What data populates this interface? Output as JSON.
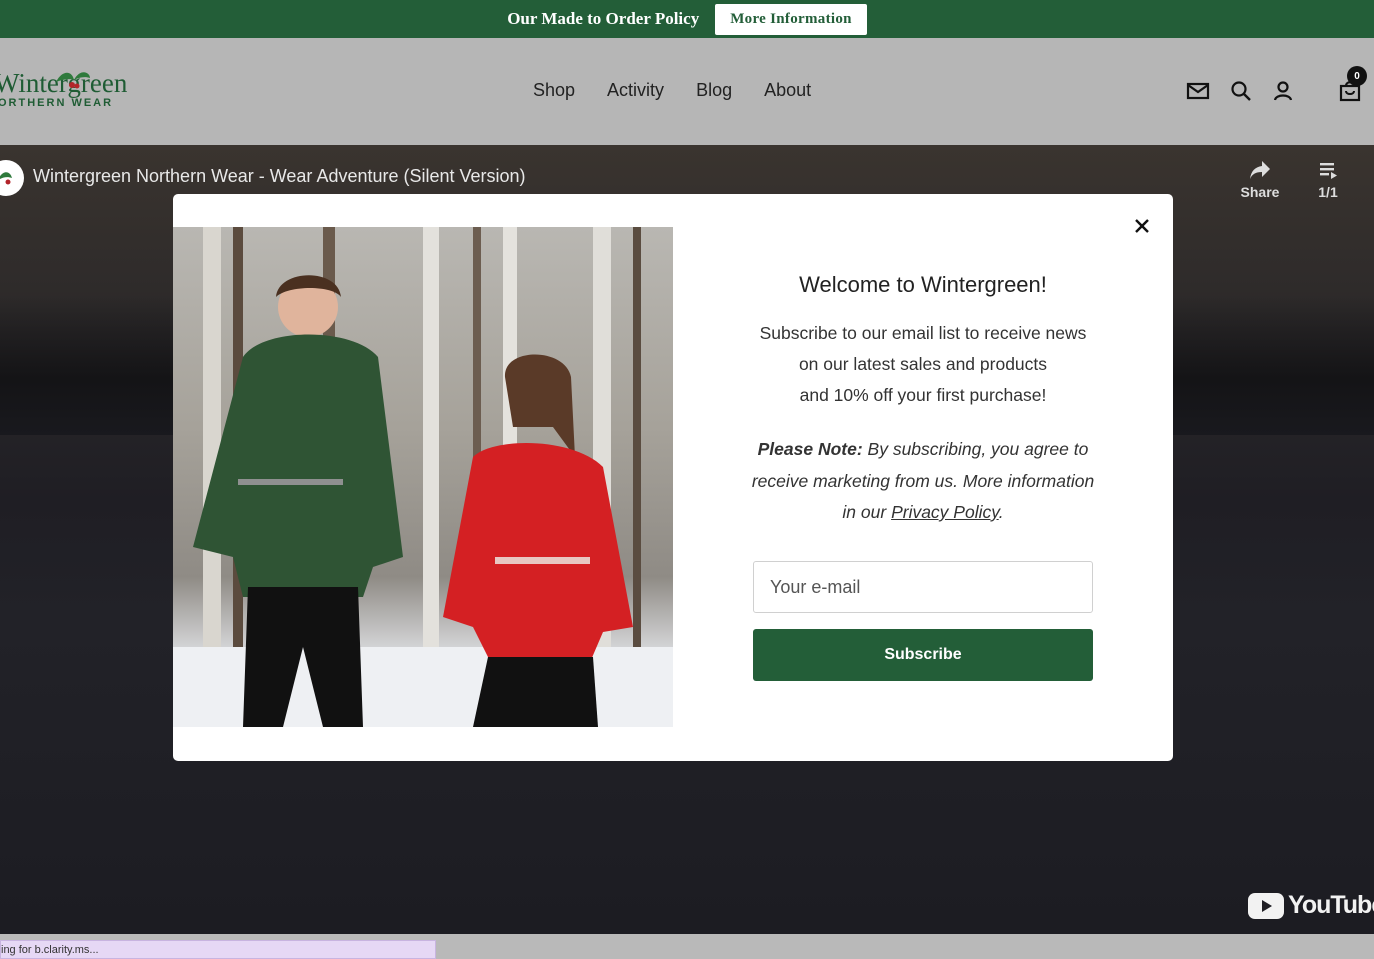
{
  "announcement": {
    "message": "Our Made to Order Policy",
    "button": "More Information"
  },
  "header": {
    "logo_line1": "Wintergreen",
    "logo_line2": "ORTHERN WEAR",
    "nav": [
      "Shop",
      "Activity",
      "Blog",
      "About"
    ],
    "icons": [
      "mail-icon",
      "search-icon",
      "account-icon",
      "cart-icon"
    ],
    "cart_count": "0"
  },
  "video": {
    "title": "Wintergreen Northern Wear - Wear Adventure (Silent Version)",
    "share_label": "Share",
    "queue_label": "1/1",
    "brand": "YouTube"
  },
  "modal": {
    "title": "Welcome to Wintergreen!",
    "body_lines": [
      "Subscribe to our email list to receive news",
      "on our latest sales and products",
      "and 10% off your first purchase!"
    ],
    "note_bold": "Please Note:",
    "note_text": " By subscribing, you agree to receive marketing from us. More information in our ",
    "note_link": "Privacy Policy",
    "note_end": ".",
    "email_placeholder": "Your e-mail",
    "subscribe_label": "Subscribe"
  },
  "status_text": "ing for b.clarity.ms...",
  "colors": {
    "brand_green": "#235e38",
    "header_bg": "#b6b6b6",
    "modal_bg": "#ffffff"
  }
}
